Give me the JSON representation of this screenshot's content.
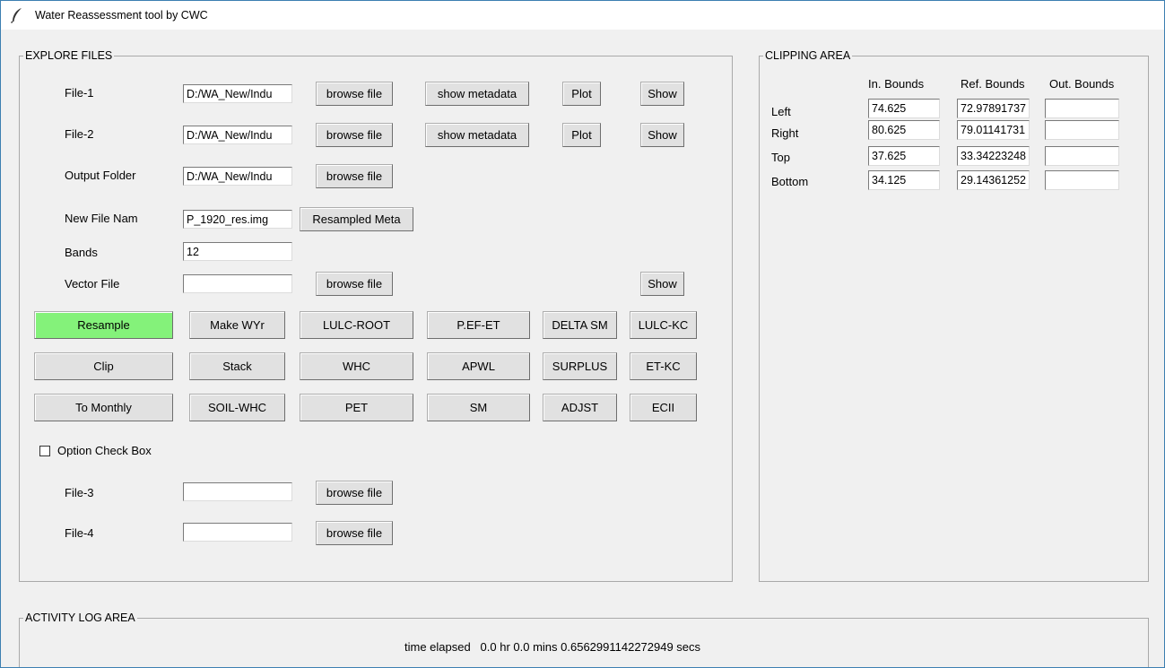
{
  "window": {
    "title": "Water Reassessment tool by CWC",
    "icon": "feather-icon"
  },
  "explore": {
    "title": "EXPLORE FILES",
    "file1": {
      "label": "File-1",
      "value": "D:/WA_New/Indu",
      "browse": "browse file",
      "metadata": "show metadata",
      "plot": "Plot",
      "show": "Show"
    },
    "file2": {
      "label": "File-2",
      "value": "D:/WA_New/Indu",
      "browse": "browse file",
      "metadata": "show metadata",
      "plot": "Plot",
      "show": "Show"
    },
    "output": {
      "label": "Output Folder",
      "value": "D:/WA_New/Indu",
      "browse": "browse file"
    },
    "newfile": {
      "label": "New File Nam",
      "value": "P_1920_res.img",
      "meta": "Resampled Meta"
    },
    "bands": {
      "label": "Bands",
      "value": "12"
    },
    "vector": {
      "label": "Vector File",
      "value": "",
      "browse": "browse file",
      "show": "Show"
    },
    "actions": {
      "resample": "Resample",
      "make_wyr": "Make WYr",
      "lulc_root": "LULC-ROOT",
      "pef_et": "P.EF-ET",
      "delta_sm": "DELTA SM",
      "lulc_kc": "LULC-KC",
      "clip": "Clip",
      "stack": "Stack",
      "whc": "WHC",
      "apwl": "APWL",
      "surplus": "SURPLUS",
      "et_kc": "ET-KC",
      "to_monthly": "To Monthly",
      "soil_whc": "SOIL-WHC",
      "pet": "PET",
      "sm": "SM",
      "adjst": "ADJST",
      "ecii": "ECII"
    },
    "option": {
      "label": "Option Check Box",
      "checked": false
    },
    "file3": {
      "label": "File-3",
      "value": "",
      "browse": "browse file"
    },
    "file4": {
      "label": "File-4",
      "value": "",
      "browse": "browse file"
    }
  },
  "clipping": {
    "title": "CLIPPING AREA",
    "headers": {
      "in": "In. Bounds",
      "ref": "Ref. Bounds",
      "out": "Out. Bounds"
    },
    "rows": [
      {
        "label": "Left",
        "in": "74.625",
        "ref": "72.97891737",
        "out": ""
      },
      {
        "label": "Right",
        "in": "80.625",
        "ref": "79.01141731",
        "out": ""
      },
      {
        "label": "Top",
        "in": "37.625",
        "ref": "33.34223248",
        "out": ""
      },
      {
        "label": "Bottom",
        "in": "34.125",
        "ref": "29.14361252",
        "out": ""
      }
    ]
  },
  "log": {
    "title": "ACTIVITY LOG AREA",
    "message": "time elapsed   0.0 hr 0.0 mins 0.6562991142272949 secs"
  },
  "colors": {
    "accent_green": "#84f27a",
    "window_border": "#3c7fb1"
  }
}
